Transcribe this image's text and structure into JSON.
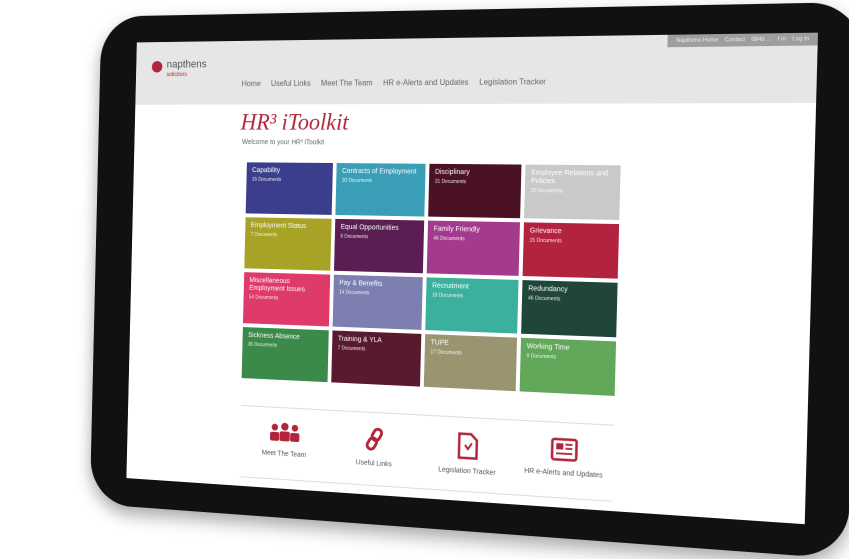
{
  "brand": {
    "name": "napthens",
    "sub": "solicitors"
  },
  "utility_links": [
    "Napthens Home",
    "Contact",
    "0845 ...",
    "f in",
    "Log In"
  ],
  "nav": [
    "Home",
    "Useful Links",
    "Meet The Team",
    "HR e-Alerts and Updates",
    "Legislation Tracker"
  ],
  "page": {
    "title": "HR³ iToolkit",
    "welcome": "Welcome to your HR³ iToolkit"
  },
  "tiles": [
    {
      "name": "Capability",
      "count": "15 Documents",
      "color": "#3b3e8c"
    },
    {
      "name": "Contracts of Employment",
      "count": "20 Documents",
      "color": "#3a9fb6"
    },
    {
      "name": "Disciplinary",
      "count": "31 Documents",
      "color": "#4a1224"
    },
    {
      "name": "Employee Relations and Policies",
      "count": "25 Documents",
      "color": "#c9c9c9"
    },
    {
      "name": "Employment Status",
      "count": "7 Documents",
      "color": "#a8a226"
    },
    {
      "name": "Equal Opportunities",
      "count": "6 Documents",
      "color": "#5b1e52"
    },
    {
      "name": "Family Friendly",
      "count": "46 Documents",
      "color": "#a33a8e"
    },
    {
      "name": "Grievance",
      "count": "15 Documents",
      "color": "#b3223e"
    },
    {
      "name": "Miscellaneous Employment Issues",
      "count": "54 Documents",
      "color": "#de3a6a"
    },
    {
      "name": "Pay & Benefits",
      "count": "14 Documents",
      "color": "#7d7fb0"
    },
    {
      "name": "Recruitment",
      "count": "18 Documents",
      "color": "#3bb09c"
    },
    {
      "name": "Redundancy",
      "count": "46 Documents",
      "color": "#1f4639"
    },
    {
      "name": "Sickness Absence",
      "count": "36 Documents",
      "color": "#3c8a4a"
    },
    {
      "name": "Training & YLA",
      "count": "7 Documents",
      "color": "#5a1a2e"
    },
    {
      "name": "TUPE",
      "count": "17 Documents",
      "color": "#9a9570"
    },
    {
      "name": "Working Time",
      "count": "9 Documents",
      "color": "#62a75a"
    }
  ],
  "shortcuts": [
    {
      "label": "Meet The Team",
      "icon": "team-icon"
    },
    {
      "label": "Useful Links",
      "icon": "link-icon"
    },
    {
      "label": "Legislation Tracker",
      "icon": "document-icon"
    },
    {
      "label": "HR e-Alerts and Updates",
      "icon": "newspaper-icon"
    }
  ],
  "colors": {
    "accent": "#b1243a",
    "bezel": "#111111"
  }
}
